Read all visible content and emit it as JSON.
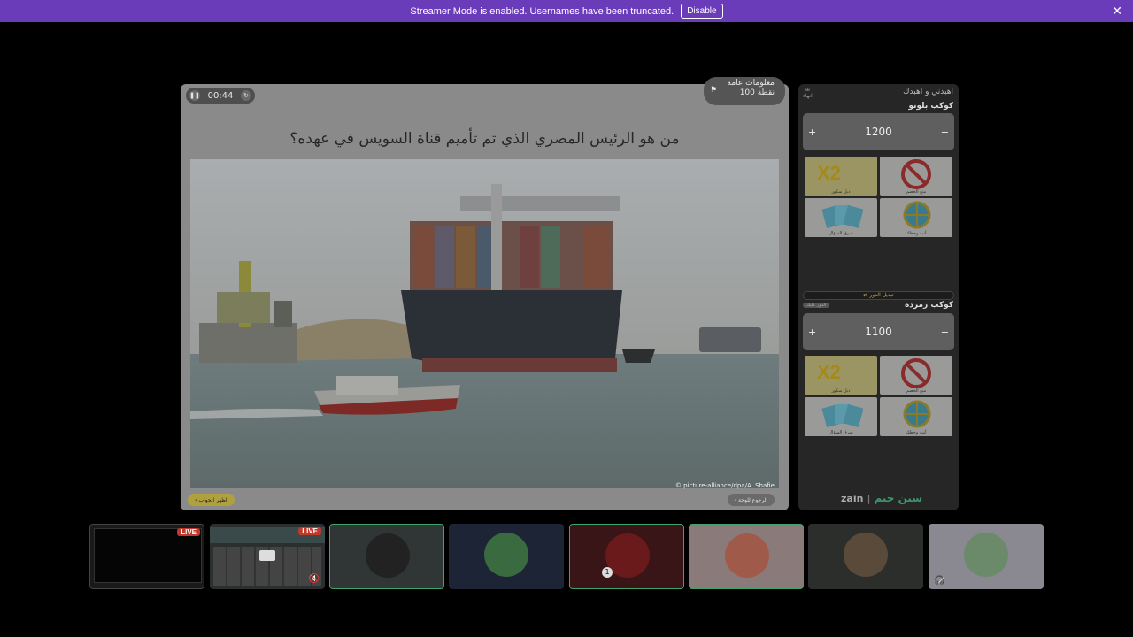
{
  "banner": {
    "message": "Streamer Mode is enabled. Usernames have been truncated.",
    "disable_label": "Disable"
  },
  "game": {
    "timer": "00:44",
    "category_name": "معلومات عامة",
    "category_points": "100 نقطة",
    "question": "من هو الرئيس المصري الذي تم تأميم قناة السويس في عهده؟",
    "photo_credit": "© picture-alliance/dpa/A. Shafie",
    "show_answer_label": "اظهر الجواب",
    "back_label": "الرجوع للوحة"
  },
  "sidebar": {
    "title": "اهبدني و اهبدك",
    "exit_label": "انهاء",
    "turn_label": "تبديل الدور",
    "turn_badge": "الدور عليك",
    "teams": [
      {
        "name": "كوكب بلوتو",
        "score": "1200",
        "lifelines": [
          {
            "icon": "double-score-icon",
            "label": "X2",
            "caption": "دبل سكور"
          },
          {
            "icon": "no-answer-icon",
            "caption": "منع الخصم"
          },
          {
            "icon": "cards-icon",
            "caption": "سرق السؤال"
          },
          {
            "icon": "wheel-icon",
            "caption": "أنت وحظك"
          }
        ]
      },
      {
        "name": "كوكب زمردة",
        "score": "1100",
        "lifelines": [
          {
            "icon": "double-score-icon",
            "label": "X2",
            "caption": "دبل سكور"
          },
          {
            "icon": "no-answer-icon",
            "caption": "منع الخصم"
          },
          {
            "icon": "cards-icon",
            "caption": "سرق السؤال"
          },
          {
            "icon": "wheel-icon",
            "caption": "أنت وحظك"
          }
        ]
      }
    ],
    "logo_text": "zain",
    "logo_brand": "سين جيم"
  },
  "participants": {
    "live_label": "LIVE",
    "tiles": [
      {
        "kind": "stream-screen",
        "live": true
      },
      {
        "kind": "stream-board",
        "live": true,
        "muted": true
      },
      {
        "kind": "avatar",
        "speaking": true
      },
      {
        "kind": "avatar"
      },
      {
        "kind": "avatar",
        "speaking": true,
        "badge": "1"
      },
      {
        "kind": "avatar",
        "speaking": true
      },
      {
        "kind": "avatar"
      },
      {
        "kind": "avatar",
        "deafened": true
      }
    ]
  }
}
